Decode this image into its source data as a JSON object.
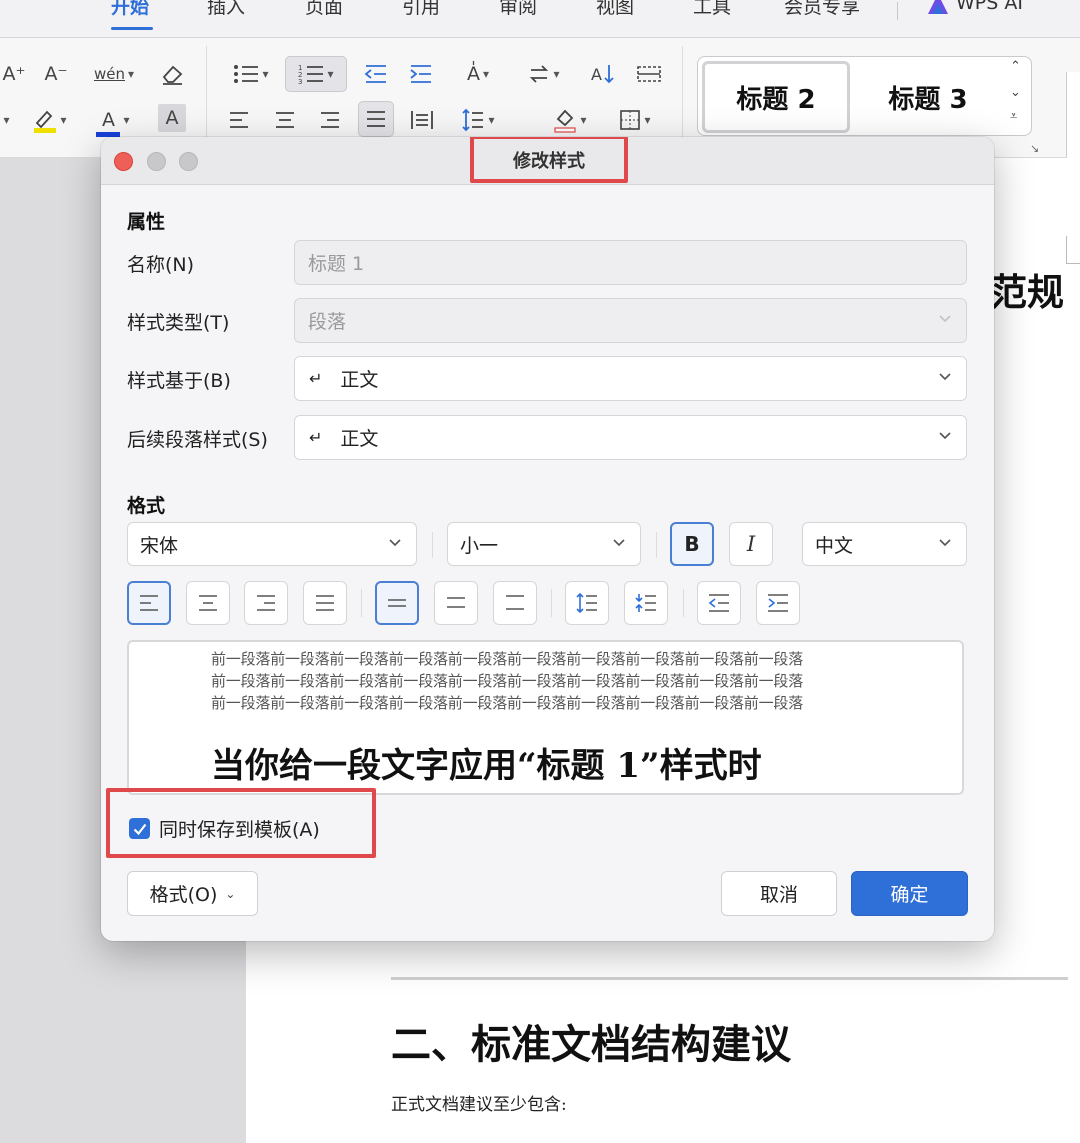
{
  "tabs": [
    "开始",
    "插入",
    "页面",
    "引用",
    "审阅",
    "视图",
    "工具",
    "会员专享",
    "WPS AI"
  ],
  "ribbon": {
    "grow_font": "A⁺",
    "shrink_font": "A⁻",
    "phonetic": "wén",
    "char_shading": "A",
    "font_color": "A",
    "style_h2": "标题 2",
    "style_h3": "标题 3",
    "highlight_color": "#f0e000",
    "font_color_value": "#1a3fd8"
  },
  "document": {
    "heading_fragment": "范规",
    "section_heading": "二、标准文档结构建议",
    "paragraph": "正式文档建议至少包含:"
  },
  "dialog": {
    "title": "修改样式",
    "properties_section": "属性",
    "name_label": "名称(N)",
    "name_value": "标题 1",
    "type_label": "样式类型(T)",
    "type_value": "段落",
    "based_on_label": "样式基于(B)",
    "based_on_value": "正文",
    "next_label": "后续段落样式(S)",
    "next_value": "正文",
    "return_glyph": "↵",
    "format_section": "格式",
    "font_value": "宋体",
    "size_value": "小一",
    "bold_label": "B",
    "italic_label": "I",
    "script_value": "中文",
    "preview_line": "前一段落前一段落前一段落前一段落前一段落前一段落前一段落前一段落前一段落前一段落",
    "preview_heading": "当你给一段文字应用“标题 1”样式时",
    "save_to_template_label": "同时保存到模板(A)",
    "save_to_template_checked": true,
    "format_button": "格式(O)",
    "cancel_button": "取消",
    "ok_button": "确定"
  },
  "colors": {
    "accent": "#2f6fd8",
    "highlight_box": "#e0494c",
    "close_button": "#ed5f57"
  }
}
